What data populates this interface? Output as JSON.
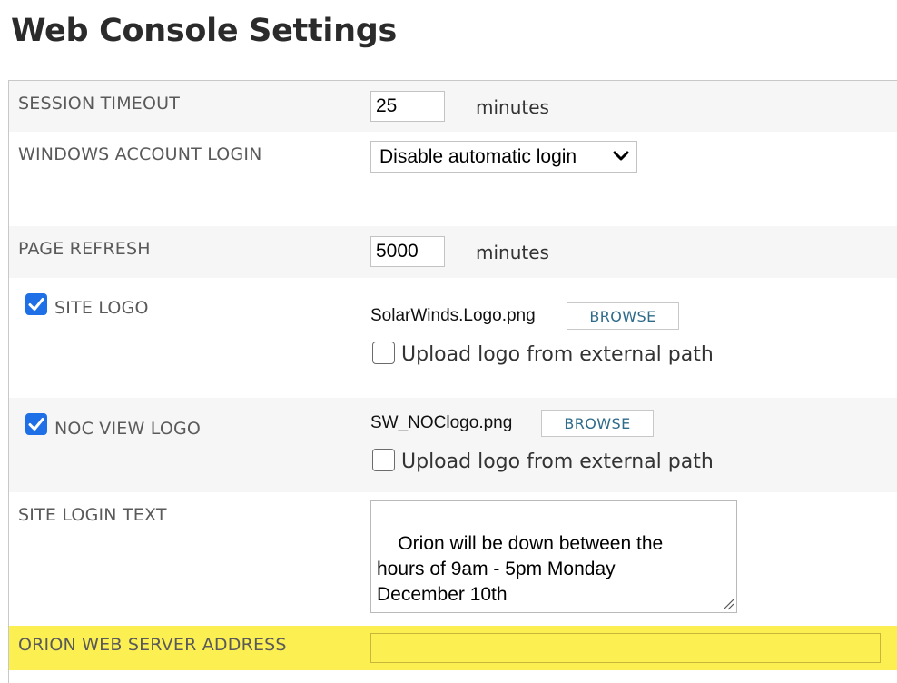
{
  "page": {
    "title": "Web Console Settings"
  },
  "session_timeout": {
    "label": "SESSION TIMEOUT",
    "value": "25",
    "unit": "minutes"
  },
  "windows_login": {
    "label": "WINDOWS ACCOUNT LOGIN",
    "selected": "Disable automatic login",
    "icon": "chevron-down-icon"
  },
  "page_refresh": {
    "label": "PAGE REFRESH",
    "value": "5000",
    "unit": "minutes"
  },
  "site_logo": {
    "label": "SITE LOGO",
    "checked": true,
    "filename": "SolarWinds.Logo.png",
    "browse_label": "BROWSE",
    "upload_label": "Upload logo from external path",
    "upload_checked": false
  },
  "noc_logo": {
    "label": "NOC VIEW LOGO",
    "checked": true,
    "filename": "SW_NOClogo.png",
    "browse_label": "BROWSE",
    "upload_label": "Upload logo from external path",
    "upload_checked": false
  },
  "site_login_text": {
    "label": "SITE LOGIN TEXT",
    "value": "Orion will be down between the\nhours of 9am - 5pm Monday\nDecember 10th"
  },
  "web_server_address": {
    "label": "ORION WEB SERVER ADDRESS",
    "value": ""
  },
  "colors": {
    "checkbox_accent": "#1f6fe6",
    "highlight": "#fbef52",
    "browse_text": "#2f6b8a",
    "row_shade": "#f6f6f6"
  }
}
